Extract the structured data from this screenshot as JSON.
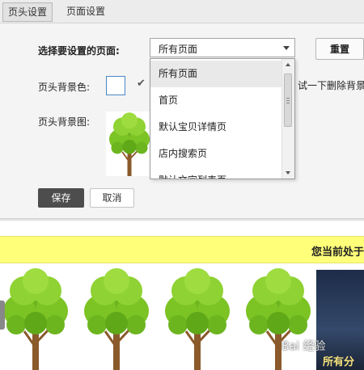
{
  "tabs": [
    {
      "label": "页头设置"
    },
    {
      "label": "页面设置"
    }
  ],
  "form": {
    "page_select_label": "选择要设置的页面:",
    "selected_value": "所有页面",
    "reset_label": "重置",
    "bg_color_label": "页头背景色:",
    "bg_image_label": "页头背景图:",
    "truncated_text": "试一下删除背景",
    "save_label": "保存",
    "cancel_label": "取消"
  },
  "dropdown": {
    "options": [
      {
        "label": "所有页面"
      },
      {
        "label": "首页"
      },
      {
        "label": "默认宝贝详情页"
      },
      {
        "label": "店内搜索页"
      },
      {
        "label": "默认文字列表页"
      }
    ]
  },
  "preview": {
    "location_text": "您当前处于",
    "photo_text": "所有分",
    "watermark": "Bai 经验"
  },
  "colors": {
    "yellow_bar": "#ffff7a",
    "save_bg": "#4d4d4d",
    "tree_leaf": "#7cc324",
    "tree_trunk": "#8a5a2b"
  }
}
